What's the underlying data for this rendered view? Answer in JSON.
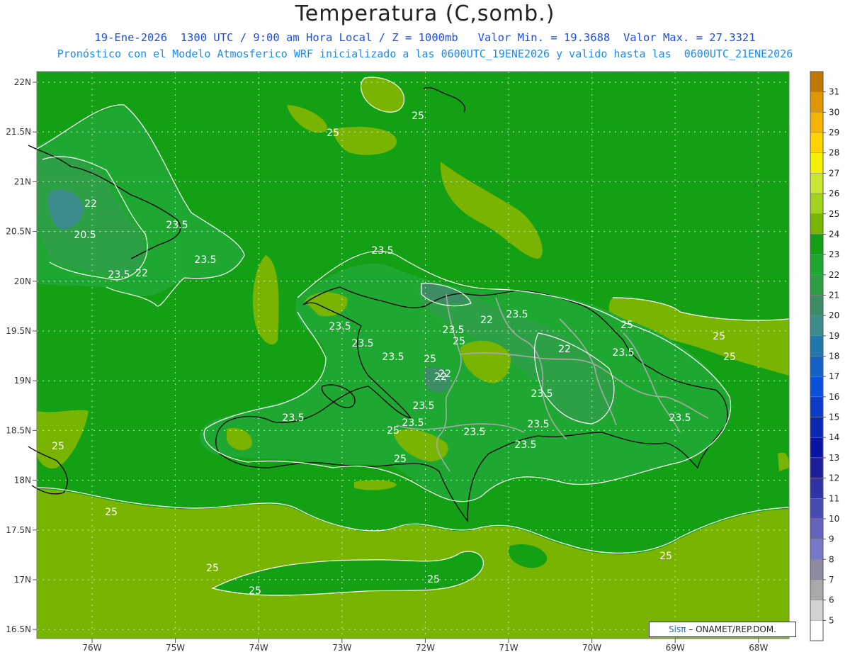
{
  "header": {
    "title": "Temperatura (C,somb.)",
    "subtitle_1": "19-Ene-2026  1300 UTC / 9:00 am Hora Local / Z = 1000mb   Valor Min. = 19.3688  Valor Max. = 27.3321",
    "subtitle_2": "Pronóstico con el Modelo Atmosferico WRF inicializado a las 0600UTC_19ENE2026 y valido hasta las  0600UTC_21ENE2026"
  },
  "credit": {
    "sis": "Sisπ",
    "rest": "– ONAMET/REP.DOM."
  },
  "axes": {
    "lat_labels": [
      "22N",
      "21.5N",
      "21N",
      "20.5N",
      "20N",
      "19.5N",
      "19N",
      "18.5N",
      "18N",
      "17.5N",
      "17N",
      "16.5N"
    ],
    "lon_labels": [
      "76W",
      "75W",
      "74W",
      "73W",
      "72W",
      "71W",
      "70W",
      "69W",
      "68W"
    ]
  },
  "colorbar": {
    "labels": [
      "31",
      "30",
      "29",
      "28",
      "27",
      "26",
      "25",
      "24",
      "23",
      "22",
      "21",
      "20",
      "19",
      "18",
      "17",
      "16",
      "15",
      "14",
      "13",
      "12",
      "11",
      "10",
      "9",
      "8",
      "7",
      "6",
      "5"
    ],
    "colors": [
      "#c07800",
      "#e09600",
      "#f5b400",
      "#ffd200",
      "#f5f000",
      "#c8e632",
      "#a0d21e",
      "#78b400",
      "#14a014",
      "#1ea832",
      "#2da046",
      "#3c8c64",
      "#3c8c8c",
      "#1e78aa",
      "#1464c8",
      "#0a50dc",
      "#0a3cc8",
      "#0a28b4",
      "#0a14a0",
      "#1e1e9b",
      "#3232a5",
      "#4b4bb4",
      "#6464be",
      "#7878c8",
      "#8c8ca0",
      "#aaaaaa",
      "#d2d2d2",
      "#ffffff"
    ]
  },
  "contours": {
    "values": [
      "25",
      "25",
      "25",
      "25",
      "25",
      "25",
      "25",
      "25",
      "25",
      "25",
      "25",
      "25",
      "25",
      "25",
      "25",
      "22",
      "22",
      "22",
      "22",
      "22",
      "20.5",
      "23.5",
      "23.5",
      "23.5",
      "23.5",
      "23.5",
      "23.5",
      "23.5",
      "23.5",
      "23.5",
      "23.5",
      "23.5",
      "23.5",
      "23.5",
      "23.5",
      "23.5",
      "23.5",
      "23.5",
      "22",
      "23.5"
    ]
  }
}
